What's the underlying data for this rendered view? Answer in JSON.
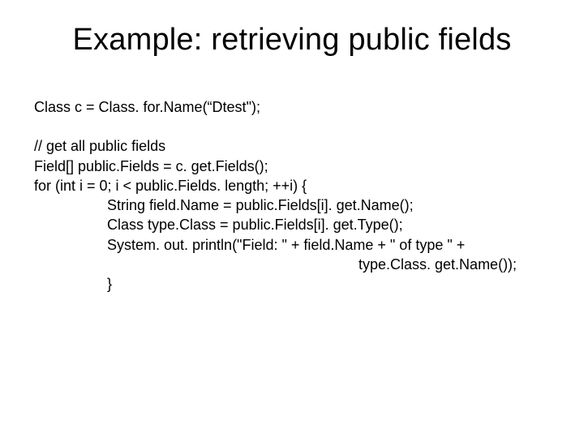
{
  "title": "Example: retrieving public fields",
  "code": {
    "l1": "Class c = Class. for.Name(“Dtest\");",
    "l2": "// get all public fields",
    "l3": "Field[] public.Fields = c. get.Fields();",
    "l4": "for (int i = 0; i < public.Fields. length; ++i) {",
    "l5": "String field.Name = public.Fields[i]. get.Name();",
    "l6": "Class type.Class = public.Fields[i]. get.Type();",
    "l7": "System. out. println(\"Field: \" + field.Name + \" of type \" +",
    "l8": "type.Class. get.Name());",
    "l9": "}"
  }
}
